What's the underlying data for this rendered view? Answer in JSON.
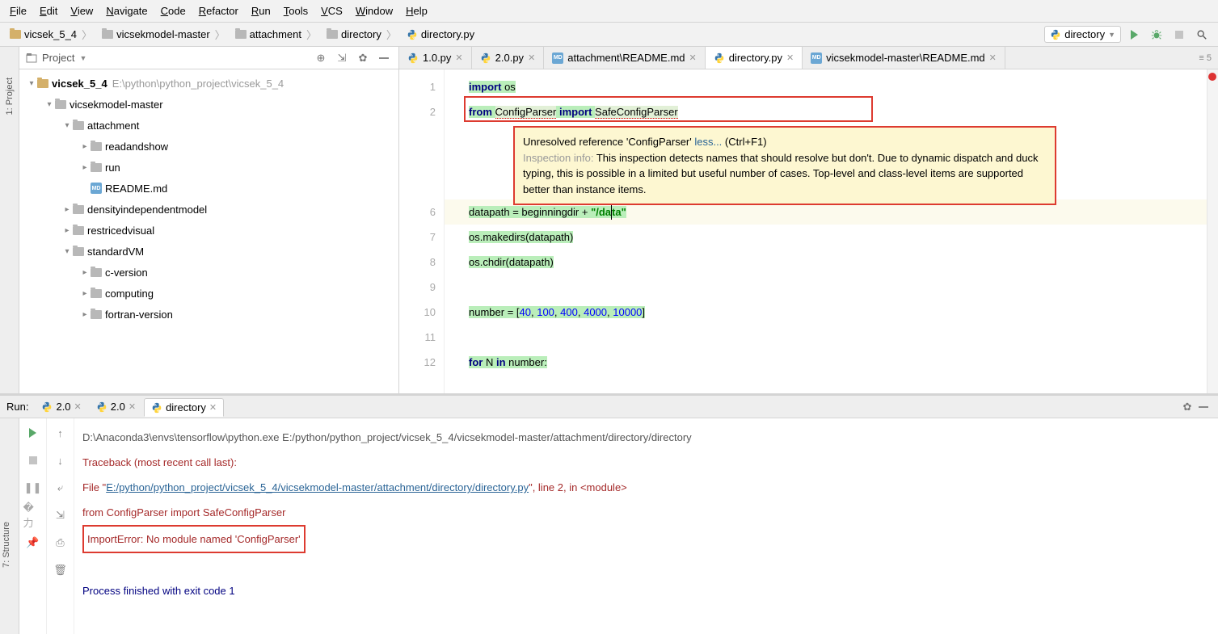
{
  "menubar": [
    "File",
    "Edit",
    "View",
    "Navigate",
    "Code",
    "Refactor",
    "Run",
    "Tools",
    "VCS",
    "Window",
    "Help"
  ],
  "breadcrumb": {
    "items": [
      "vicsek_5_4",
      "vicsekmodel-master",
      "attachment",
      "directory"
    ],
    "file": "directory.py"
  },
  "run_config": {
    "label": "directory"
  },
  "side_tabs": {
    "project": "1: Project",
    "structure": "7: Structure"
  },
  "project": {
    "title": "Project",
    "root": {
      "name": "vicsek_5_4",
      "path": "E:\\python\\python_project\\vicsek_5_4"
    },
    "nodes": [
      {
        "indent": 1,
        "exp": true,
        "name": "vicsekmodel-master"
      },
      {
        "indent": 2,
        "exp": true,
        "name": "attachment"
      },
      {
        "indent": 3,
        "exp": false,
        "name": "readandshow"
      },
      {
        "indent": 3,
        "exp": false,
        "name": "run"
      },
      {
        "indent": 3,
        "file": "md",
        "name": "README.md"
      },
      {
        "indent": 2,
        "exp": false,
        "name": "densityindependentmodel"
      },
      {
        "indent": 2,
        "exp": false,
        "name": "restricedvisual"
      },
      {
        "indent": 2,
        "exp": true,
        "name": "standardVM"
      },
      {
        "indent": 3,
        "exp": false,
        "name": "c-version"
      },
      {
        "indent": 3,
        "exp": false,
        "name": "computing"
      },
      {
        "indent": 3,
        "exp": false,
        "name": "fortran-version"
      }
    ]
  },
  "tabs": [
    {
      "icon": "py",
      "label": "1.0.py"
    },
    {
      "icon": "py",
      "label": "2.0.py"
    },
    {
      "icon": "md",
      "label": "attachment\\README.md"
    },
    {
      "icon": "py",
      "label": "directory.py",
      "active": true
    },
    {
      "icon": "md",
      "label": "vicsekmodel-master\\README.md"
    }
  ],
  "tabs_overflow": "≡ 5",
  "code": {
    "line1_kw": "import",
    "line1_rest": " os",
    "line2_kw1": "from ",
    "line2_err1": "ConfigParser",
    "line2_kw2": " import ",
    "line2_err2": "SafeConfigParser",
    "line6_a": "datapath = beginningdir + ",
    "line6_str1": "\"/da",
    "line6_str2": "ta\"",
    "line7": "os.makedirs(datapath)",
    "line8": "os.chdir(datapath)",
    "line10_a": "number = [",
    "line10_n1": "40",
    "line10_n2": "100",
    "line10_n3": "400",
    "line10_n4": "4000",
    "line10_n5": "10000",
    "line10_c": ", ",
    "line10_e": "]",
    "line12_kw1": "for",
    "line12_mid": " N ",
    "line12_kw2": "in",
    "line12_end": " number:"
  },
  "tooltip": {
    "title": "Unresolved reference 'ConfigParser' ",
    "less": "less...",
    "shortcut": " (Ctrl+F1)",
    "info_label": "Inspection info: ",
    "info_text": "This inspection detects names that should resolve but don't. Due to dynamic dispatch and duck typing, this is possible in a limited but useful number of cases. Top-level and class-level items are supported better than instance items."
  },
  "run": {
    "title": "Run:",
    "tabs": [
      {
        "label": "2.0"
      },
      {
        "label": "2.0"
      },
      {
        "label": "directory",
        "active": true
      }
    ]
  },
  "console": {
    "cmd": "D:\\Anaconda3\\envs\\tensorflow\\python.exe E:/python/python_project/vicsek_5_4/vicsekmodel-master/attachment/directory/directory",
    "tb": "Traceback (most recent call last):",
    "file_pre": "  File \"",
    "file_link": "E:/python/python_project/vicsek_5_4/vicsekmodel-master/attachment/directory/directory.py",
    "file_post": "\", line 2, in <module>",
    "from_line": "    from ConfigParser import SafeConfigParser",
    "error": "ImportError: No module named 'ConfigParser'",
    "exit": "Process finished with exit code 1"
  }
}
